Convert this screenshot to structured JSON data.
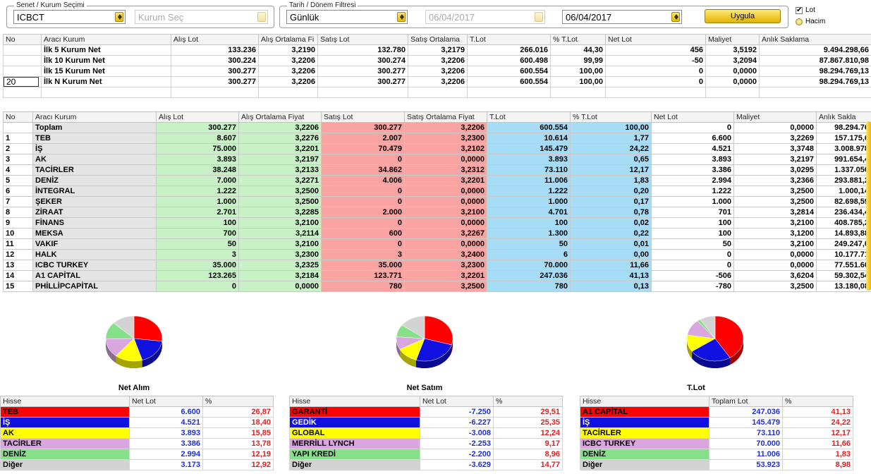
{
  "filters": {
    "senet_legend": "Senet / Kurum Seçimi",
    "senet_value": "ICBCT",
    "kurum_placeholder": "Kurum Seç",
    "tarih_legend": "Tarih / Dönem Filtresi",
    "period_value": "Günlük",
    "start_date": "06/04/2017",
    "end_date": "06/04/2017",
    "apply_label": "Uygula",
    "radio_lot": "Lot",
    "radio_hacim": "Hacim"
  },
  "summary": {
    "headers": [
      "No",
      "Aracı Kurum",
      "Alış Lot",
      "Alış Ortalama Fi",
      "Satış Lot",
      "Satış Ortalama",
      "T.Lot",
      "% T.Lot",
      "Net Lot",
      "Maliyet",
      "Anlık Saklama"
    ],
    "n_input": "20",
    "rows": [
      [
        "",
        "İlk 5 Kurum Net",
        "133.236",
        "3,2190",
        "132.780",
        "3,2179",
        "266.016",
        "44,30",
        "456",
        "3,5192",
        "9.494.298,66"
      ],
      [
        "",
        "İlk 10 Kurum Net",
        "300.224",
        "3,2206",
        "300.274",
        "3,2206",
        "600.498",
        "99,99",
        "-50",
        "3,2094",
        "87.867.810,98"
      ],
      [
        "",
        "İlk 15 Kurum Net",
        "300.277",
        "3,2206",
        "300.277",
        "3,2206",
        "600.554",
        "100,00",
        "0",
        "0,0000",
        "98.294.769,13"
      ],
      [
        "",
        "İlk N Kurum Net",
        "300.277",
        "3,2206",
        "300.277",
        "3,2206",
        "600.554",
        "100,00",
        "0",
        "0,0000",
        "98.294.769,13"
      ]
    ]
  },
  "main": {
    "headers": [
      "No",
      "Aracı Kurum",
      "Alış Lot",
      "Alış Ortalama Fiyat",
      "Satış Lot",
      "Satış Ortalama Fiyat",
      "T.Lot",
      "% T.Lot",
      "Net Lot",
      "Maliyet",
      "Anlık Sakla"
    ],
    "rows": [
      [
        "",
        "Toplam",
        "300.277",
        "3,2206",
        "300.277",
        "3,2206",
        "600.554",
        "100,00",
        "0",
        "0,0000",
        "98.294.76"
      ],
      [
        "1",
        "TEB",
        "8.607",
        "3,2276",
        "2.007",
        "3,2300",
        "10.614",
        "1,77",
        "6.600",
        "3,2269",
        "157.175,6"
      ],
      [
        "2",
        "İŞ",
        "75.000",
        "3,2201",
        "70.479",
        "3,2102",
        "145.479",
        "24,22",
        "4.521",
        "3,3748",
        "3.008.978"
      ],
      [
        "3",
        "AK",
        "3.893",
        "3,2197",
        "0",
        "0,0000",
        "3.893",
        "0,65",
        "3.893",
        "3,2197",
        "991.654,4"
      ],
      [
        "4",
        "TACİRLER",
        "38.248",
        "3,2133",
        "34.862",
        "3,2312",
        "73.110",
        "12,17",
        "3.386",
        "3,0295",
        "1.337.050"
      ],
      [
        "5",
        "DENİZ",
        "7.000",
        "3,2271",
        "4.006",
        "3,2201",
        "11.006",
        "1,83",
        "2.994",
        "3,2366",
        "293.881,2"
      ],
      [
        "6",
        "İNTEGRAL",
        "1.222",
        "3,2500",
        "0",
        "0,0000",
        "1.222",
        "0,20",
        "1.222",
        "3,2500",
        "1.000,14"
      ],
      [
        "7",
        "ŞEKER",
        "1.000",
        "3,2500",
        "0",
        "0,0000",
        "1.000",
        "0,17",
        "1.000",
        "3,2500",
        "82.698,59"
      ],
      [
        "8",
        "ZİRAAT",
        "2.701",
        "3,2285",
        "2.000",
        "3,2100",
        "4.701",
        "0,78",
        "701",
        "3,2814",
        "236.434,4"
      ],
      [
        "9",
        "FİNANS",
        "100",
        "3,2100",
        "0",
        "0,0000",
        "100",
        "0,02",
        "100",
        "3,2100",
        "408.785,2"
      ],
      [
        "10",
        "MEKSA",
        "700",
        "3,2114",
        "600",
        "3,2267",
        "1.300",
        "0,22",
        "100",
        "3,1200",
        "14.893,88"
      ],
      [
        "11",
        "VAKIF",
        "50",
        "3,2100",
        "0",
        "0,0000",
        "50",
        "0,01",
        "50",
        "3,2100",
        "249.247,0"
      ],
      [
        "12",
        "HALK",
        "3",
        "3,2300",
        "3",
        "3,2400",
        "6",
        "0,00",
        "0",
        "0,0000",
        "10.177.71"
      ],
      [
        "13",
        "ICBC TURKEY",
        "35.000",
        "3,2325",
        "35.000",
        "3,2300",
        "70.000",
        "11,66",
        "0",
        "0,0000",
        "77.551.60"
      ],
      [
        "14",
        "A1 CAPİTAL",
        "123.265",
        "3,2184",
        "123.771",
        "3,2201",
        "247.036",
        "41,13",
        "-506",
        "3,6204",
        "59.302,54"
      ],
      [
        "15",
        "PHİLLİPCAPİTAL",
        "0",
        "0,0000",
        "780",
        "3,2500",
        "780",
        "0,13",
        "-780",
        "3,2500",
        "13.180,08"
      ]
    ]
  },
  "panels": [
    {
      "title": "Net Alım",
      "headers": [
        "Hisse",
        "Net Lot",
        "%"
      ],
      "rows": [
        {
          "name": "TEB",
          "value": "6.600",
          "pct": "26,87",
          "pct_num": 26.87,
          "color": "#ff0000",
          "text": "#000000"
        },
        {
          "name": "İŞ",
          "value": "4.521",
          "pct": "18,40",
          "pct_num": 18.4,
          "color": "#1010e0",
          "text": "#ffffff"
        },
        {
          "name": "AK",
          "value": "3.893",
          "pct": "15,85",
          "pct_num": 15.85,
          "color": "#ffff00",
          "text": "#000000"
        },
        {
          "name": "TACİRLER",
          "value": "3.386",
          "pct": "13,78",
          "pct_num": 13.78,
          "color": "#d9a6e0",
          "text": "#000000"
        },
        {
          "name": "DENİZ",
          "value": "2.994",
          "pct": "12,19",
          "pct_num": 12.19,
          "color": "#86e08a",
          "text": "#000000"
        },
        {
          "name": "Diğer",
          "value": "3.173",
          "pct": "12,92",
          "pct_num": 12.92,
          "color": "#d3d3d3",
          "text": "#000000"
        }
      ]
    },
    {
      "title": "Net Satım",
      "headers": [
        "Hisse",
        "Net Lot",
        "%"
      ],
      "rows": [
        {
          "name": "GARANTİ",
          "value": "-7.250",
          "pct": "29,51",
          "pct_num": 29.51,
          "color": "#ff0000",
          "text": "#000000"
        },
        {
          "name": "GEDİK",
          "value": "-6.227",
          "pct": "25,35",
          "pct_num": 25.35,
          "color": "#1010e0",
          "text": "#ffffff"
        },
        {
          "name": "GLOBAL",
          "value": "-3.008",
          "pct": "12,24",
          "pct_num": 12.24,
          "color": "#ffff00",
          "text": "#000000"
        },
        {
          "name": "MERRİLL LYNCH",
          "value": "-2.253",
          "pct": "9,17",
          "pct_num": 9.17,
          "color": "#d9a6e0",
          "text": "#000000"
        },
        {
          "name": "YAPI KREDİ",
          "value": "-2.200",
          "pct": "8,96",
          "pct_num": 8.96,
          "color": "#86e08a",
          "text": "#000000"
        },
        {
          "name": "Diğer",
          "value": "-3.629",
          "pct": "14,77",
          "pct_num": 14.77,
          "color": "#d3d3d3",
          "text": "#000000"
        }
      ]
    },
    {
      "title": "T.Lot",
      "headers": [
        "Hisse",
        "Toplam Lot",
        "%"
      ],
      "rows": [
        {
          "name": "A1 CAPİTAL",
          "value": "247.036",
          "pct": "41,13",
          "pct_num": 41.13,
          "color": "#ff0000",
          "text": "#000000"
        },
        {
          "name": "İŞ",
          "value": "145.479",
          "pct": "24,22",
          "pct_num": 24.22,
          "color": "#1010e0",
          "text": "#ffffff"
        },
        {
          "name": "TACİRLER",
          "value": "73.110",
          "pct": "12,17",
          "pct_num": 12.17,
          "color": "#ffff00",
          "text": "#000000"
        },
        {
          "name": "ICBC TURKEY",
          "value": "70.000",
          "pct": "11,66",
          "pct_num": 11.66,
          "color": "#d9a6e0",
          "text": "#000000"
        },
        {
          "name": "DENİZ",
          "value": "11.006",
          "pct": "1,83",
          "pct_num": 1.83,
          "color": "#86e08a",
          "text": "#000000"
        },
        {
          "name": "Diğer",
          "value": "53.923",
          "pct": "8,98",
          "pct_num": 8.98,
          "color": "#d3d3d3",
          "text": "#000000"
        }
      ]
    }
  ]
}
